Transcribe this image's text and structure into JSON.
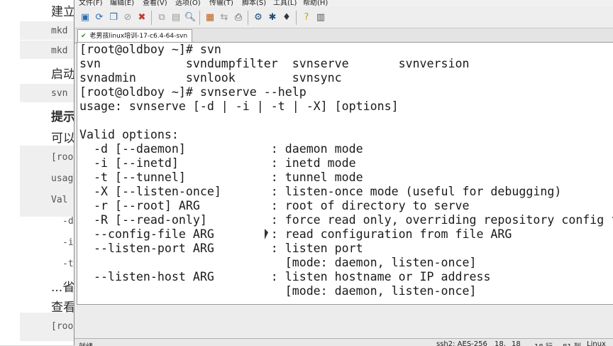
{
  "background_doc": {
    "lines": [
      "建立",
      "mkd",
      "mkd",
      "启动",
      "svn",
      "提示",
      "可以",
      "[roo",
      "usag",
      "Val",
      "-d",
      "-i",
      "-t",
      "...省",
      "查看",
      "[roo"
    ]
  },
  "menubar": {
    "items": [
      "文件(F)",
      "编辑(E)",
      "查看(V)",
      "选项(O)",
      "传输(T)",
      "脚本(S)",
      "工具(L)",
      "帮助(H)"
    ]
  },
  "toolbar": {
    "icons": [
      "new-session-icon",
      "reconnect-icon",
      "duplicate-icon",
      "disconnect-icon",
      "close-session-icon",
      "copy-icon",
      "paste-icon",
      "find-icon",
      "sftp-icon",
      "transfer-icon",
      "print-icon",
      "options-icon",
      "keymap-icon",
      "script-icon",
      "help-icon",
      "about-icon"
    ]
  },
  "tab": {
    "label": "老男孩linux培训-17-c6.4-64-svn"
  },
  "terminal": {
    "lines": [
      "[root@oldboy ~]# svn",
      "svn            svndumpfilter  svnserve       svnversion",
      "svnadmin       svnlook        svnsync",
      "[root@oldboy ~]# svnserve --help",
      "usage: svnserve [-d | -i | -t | -X] [options]",
      "",
      "Valid options:",
      "  -d [--daemon]            : daemon mode",
      "  -i [--inetd]             : inetd mode",
      "  -t [--tunnel]            : tunnel mode",
      "  -X [--listen-once]       : listen-once mode (useful for debugging)",
      "  -r [--root] ARG          : root of directory to serve",
      "  -R [--read-only]         : force read only, overriding repository config file",
      "  --config-file ARG        : read configuration from file ARG",
      "  --listen-port ARG        : listen port",
      "                             [mode: daemon, listen-once]",
      "  --listen-host ARG        : listen hostname or IP address",
      "                             [mode: daemon, listen-once]"
    ]
  },
  "statusbar": {
    "ready": "就绪",
    "session": "ssh2: AES-256",
    "row": "18,",
    "col": "18",
    "rows": "18 行,",
    "cols": "81 列",
    "os": "Linux"
  },
  "colors": {
    "terminal_bg": "#ffffff",
    "terminal_fg": "#1a1a1a",
    "chrome": "#ececec"
  }
}
